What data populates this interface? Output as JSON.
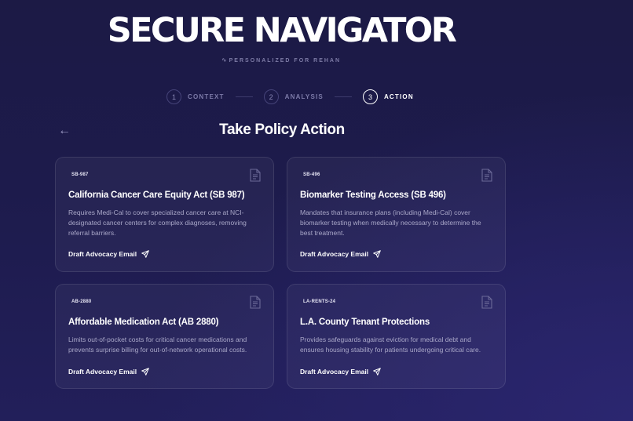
{
  "header": {
    "title": "SECURE NAVIGATOR",
    "subtitle": "PERSONALIZED FOR REHAN",
    "subtitle_icon": "pulse-icon"
  },
  "stepper": {
    "steps": [
      {
        "number": "1",
        "label": "CONTEXT",
        "state": "done"
      },
      {
        "number": "2",
        "label": "ANALYSIS",
        "state": "done"
      },
      {
        "number": "3",
        "label": "ACTION",
        "state": "active"
      }
    ]
  },
  "main": {
    "back_icon": "←",
    "heading": "Take Policy Action",
    "cards": [
      {
        "tag": "SB-987",
        "title": "California Cancer Care Equity Act (SB 987)",
        "description": "Requires Medi-Cal to cover specialized cancer care at NCI-designated cancer centers for complex diagnoses, removing referral barriers.",
        "cta": "Draft Advocacy Email"
      },
      {
        "tag": "SB-496",
        "title": "Biomarker Testing Access (SB 496)",
        "description": "Mandates that insurance plans (including Medi-Cal) cover biomarker testing when medically necessary to determine the best treatment.",
        "cta": "Draft Advocacy Email"
      },
      {
        "tag": "AB-2880",
        "title": "Affordable Medication Act (AB 2880)",
        "description": "Limits out-of-pocket costs for critical cancer medications and prevents surprise billing for out-of-network operational costs.",
        "cta": "Draft Advocacy Email"
      },
      {
        "tag": "LA-RENTS-24",
        "title": "L.A. County Tenant Protections",
        "description": "Provides safeguards against eviction for medical debt and ensures housing stability for patients undergoing critical care.",
        "cta": "Draft Advocacy Email"
      }
    ]
  },
  "colors": {
    "background": "#1d1b4c",
    "accent_text": "#ffffff",
    "muted_text": "#a9a7c8"
  }
}
